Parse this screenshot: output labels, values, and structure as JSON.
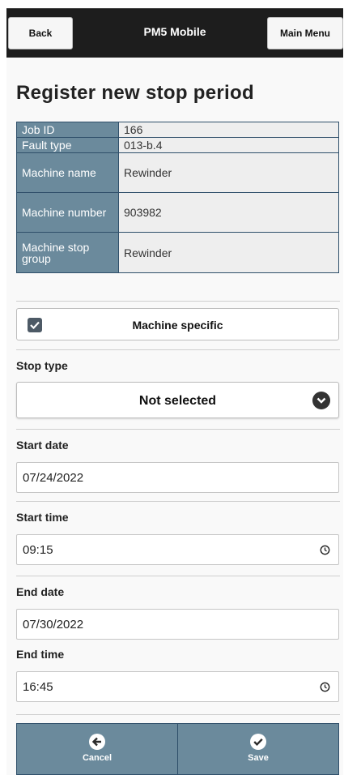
{
  "header": {
    "back_label": "Back",
    "title": "PM5 Mobile",
    "main_menu_label": "Main Menu"
  },
  "page": {
    "title": "Register new stop period"
  },
  "info_table": [
    {
      "key": "Job ID",
      "value": "166"
    },
    {
      "key": "Fault type",
      "value": "013-b.4"
    },
    {
      "key": "Machine name",
      "value": "Rewinder"
    },
    {
      "key": "Machine number",
      "value": "903982"
    },
    {
      "key": "Machine stop group",
      "value": "Rewinder"
    }
  ],
  "machine_specific": {
    "label": "Machine specific",
    "checked": true
  },
  "stop_type": {
    "label": "Stop type",
    "selected": "Not selected"
  },
  "start_date": {
    "label": "Start date",
    "value": "07/24/2022"
  },
  "start_time": {
    "label": "Start time",
    "value": "09:15"
  },
  "end_date": {
    "label": "End date",
    "value": "07/30/2022"
  },
  "end_time": {
    "label": "End time",
    "value": "16:45"
  },
  "footer": {
    "cancel_label": "Cancel",
    "save_label": "Save"
  },
  "colors": {
    "header_bg": "#1d1d1d",
    "table_key_bg": "#6b8a9c",
    "table_border": "#2f4f6a",
    "footer_bg": "#6b8a9c"
  }
}
